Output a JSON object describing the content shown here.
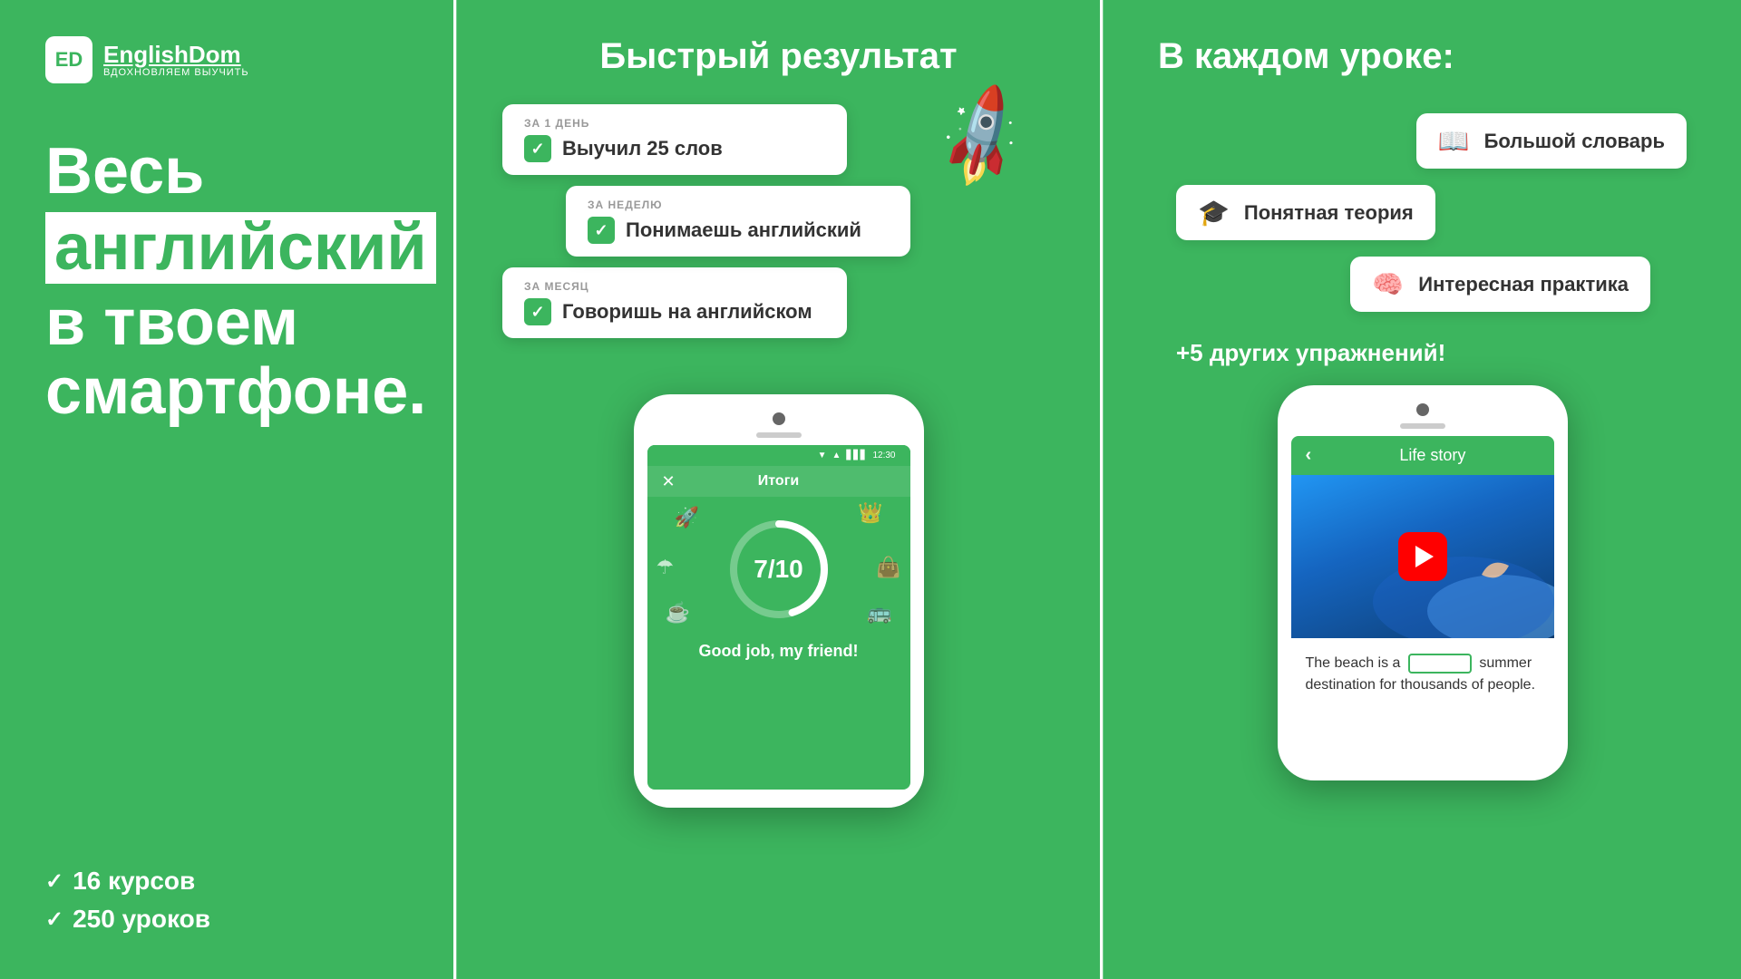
{
  "left": {
    "logo_icon": "ED",
    "logo_name": "EnglishDom",
    "logo_tagline": "ВДОХНОВЛЯЕМ ВЫУЧИТЬ",
    "hero_line1": "Весь",
    "hero_highlight": "английский",
    "hero_line3": "в твоем",
    "hero_line4": "смартфоне.",
    "stat1": "16 курсов",
    "stat2": "250 уроков"
  },
  "middle": {
    "title": "Быстрый результат",
    "card1_label": "ЗА 1 ДЕНЬ",
    "card1_text": "Выучил 25 слов",
    "card2_label": "ЗА НЕДЕЛЮ",
    "card2_text": "Понимаешь английский",
    "card3_label": "ЗА МЕСЯЦ",
    "card3_text": "Говоришь на английском",
    "phone_time": "12:30",
    "phone_nav": "Итоги",
    "score": "7/10",
    "good_job": "Good job, my friend!"
  },
  "right": {
    "title": "В каждом уроке:",
    "feature1_icon": "📖",
    "feature1_label": "Большой словарь",
    "feature2_icon": "🎓",
    "feature2_label": "Понятная теория",
    "feature3_icon": "🧠",
    "feature3_label": "Интересная практика",
    "more_exercises": "+5 других упражнений!",
    "phone_back": "‹",
    "phone_title": "Life story",
    "video_text_1": "The beach is a",
    "video_blank": "",
    "video_text_2": "summer",
    "video_text_3": "destination for thousands of people."
  }
}
